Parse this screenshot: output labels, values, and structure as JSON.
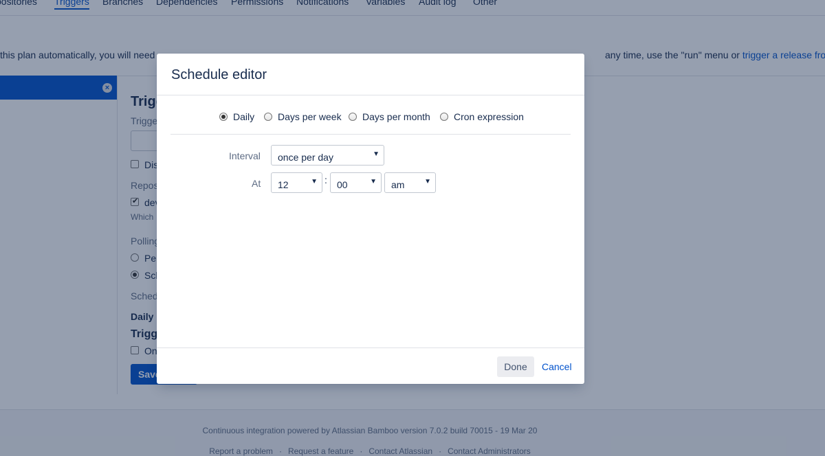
{
  "tabs": [
    "positories",
    "Triggers",
    "Branches",
    "Dependencies",
    "Permissions",
    "Notifications",
    "Variables",
    "Audit log",
    "Other"
  ],
  "intro": {
    "text": " this plan automatically, you will need",
    "text_right": "any time, use the \"run\" menu or ",
    "link": "trigger a release from Ji"
  },
  "background_form": {
    "heading": "Trigg",
    "trigger_label": "Trigge",
    "disabled_label": "Dis",
    "repos_label": "Repos",
    "repo_item": "dev",
    "which_hint": "Which",
    "polling_label": "Polling",
    "periodically": "Per",
    "scheduled": "Sch",
    "schedule_label": "Sched",
    "schedule_value": "Daily",
    "conditions_heading": "Trigg",
    "only_label": "On",
    "save_label": "Save"
  },
  "dialog": {
    "title": "Schedule editor",
    "frequency_options": [
      "Daily",
      "Days per week",
      "Days per month",
      "Cron expression"
    ],
    "frequency_selected": "Daily",
    "interval_label": "Interval",
    "interval_value": "once per day",
    "at_label": "At",
    "hour_value": "12",
    "minute_value": "00",
    "ampm_value": "am",
    "time_separator": ":",
    "done_label": "Done",
    "cancel_label": "Cancel"
  },
  "footer": {
    "powered_by": "Continuous integration powered by Atlassian Bamboo version 7.0.2 build 70015 - 19 Mar 20",
    "links": [
      "Report a problem",
      "Request a feature",
      "Contact Atlassian",
      "Contact Administrators"
    ],
    "separator": "·"
  }
}
